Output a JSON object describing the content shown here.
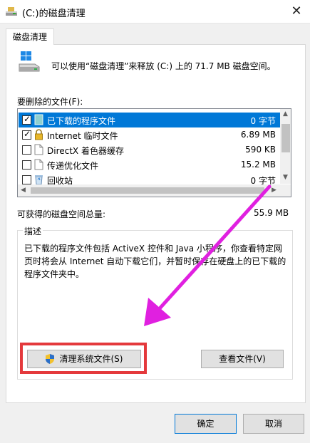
{
  "window": {
    "title": "(C:)的磁盘清理",
    "close_glyph": "✕"
  },
  "tabs": [
    {
      "label": "磁盘清理"
    }
  ],
  "summary": {
    "text": "可以使用“磁盘清理”来释放 (C:) 上的 71.7 MB 磁盘空间。"
  },
  "files_label": "要删除的文件(F):",
  "files": [
    {
      "name": "已下载的程序文件",
      "size": "0 字节",
      "checked": true,
      "selected": true,
      "icon": "folder-icon"
    },
    {
      "name": "Internet 临时文件",
      "size": "6.89 MB",
      "checked": true,
      "selected": false,
      "icon": "lock-icon"
    },
    {
      "name": "DirectX 着色器缓存",
      "size": "590 KB",
      "checked": false,
      "selected": false,
      "icon": "file-icon"
    },
    {
      "name": "传递优化文件",
      "size": "15.2 MB",
      "checked": false,
      "selected": false,
      "icon": "file-icon"
    },
    {
      "name": "回收站",
      "size": "0 字节",
      "checked": false,
      "selected": false,
      "icon": "recycle-bin-icon"
    }
  ],
  "gain": {
    "label": "可获得的磁盘空间总量:",
    "value": "55.9 MB"
  },
  "description": {
    "title": "描述",
    "text": "已下载的程序文件包括 ActiveX 控件和 Java 小程序，你查看特定网页时将会从 Internet 自动下载它们，并暂时保存在硬盘上的已下载的程序文件夹中。"
  },
  "buttons": {
    "cleanup": "清理系统文件(S)",
    "view": "查看文件(V)",
    "ok": "确定",
    "cancel": "取消"
  },
  "colors": {
    "selection": "#0078d7",
    "highlight_box": "#e4393c",
    "annotation_arrow": "#e020e0"
  }
}
